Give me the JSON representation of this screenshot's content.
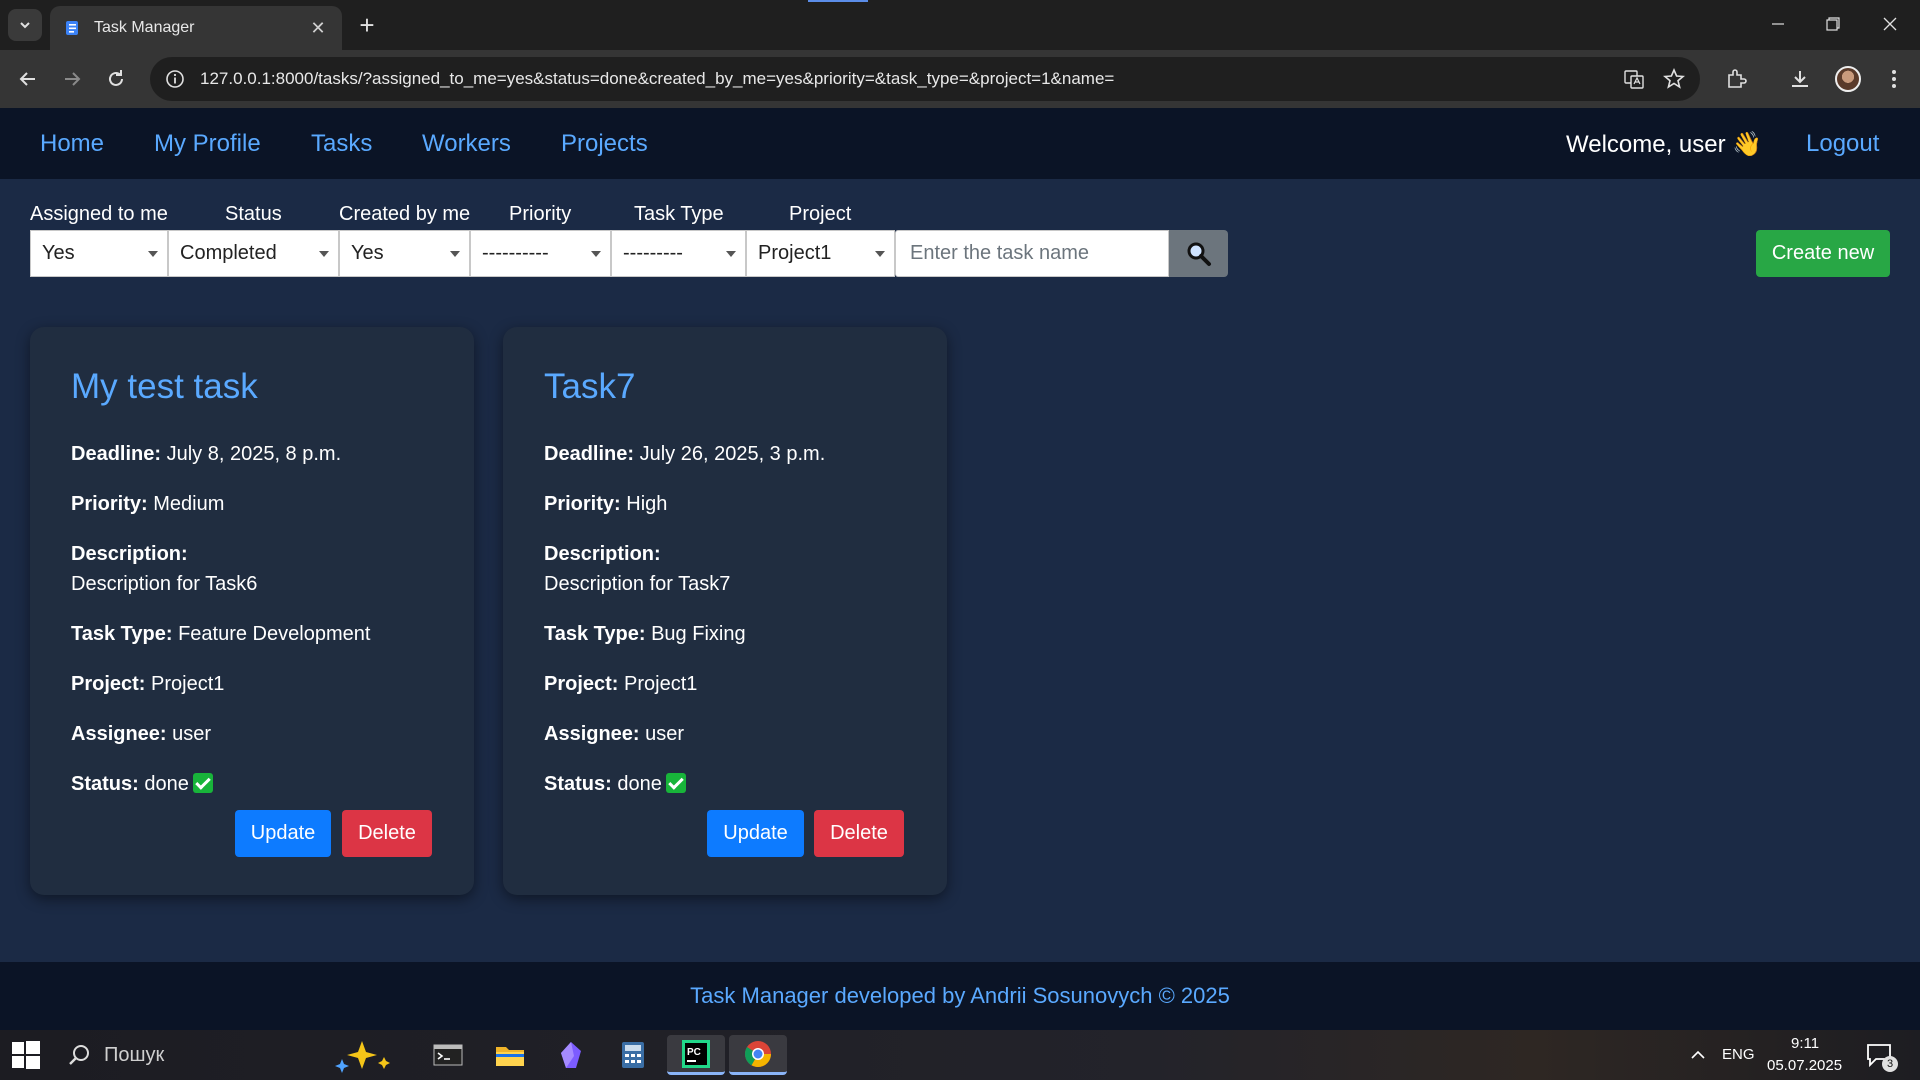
{
  "browser": {
    "tab_title": "Task Manager",
    "url": "127.0.0.1:8000/tasks/?assigned_to_me=yes&status=done&created_by_me=yes&priority=&task_type=&project=1&name="
  },
  "nav": {
    "links": [
      "Home",
      "My Profile",
      "Tasks",
      "Workers",
      "Projects"
    ],
    "welcome": "Welcome, user 👋",
    "logout": "Logout"
  },
  "filters": {
    "labels": [
      "Assigned to me",
      "Status",
      "Created by me",
      "Priority",
      "Task Type",
      "Project"
    ],
    "values": [
      "Yes",
      "Completed",
      "Yes",
      "----------",
      "---------",
      "Project1"
    ],
    "search_placeholder": "Enter the task name",
    "create_label": "Create new"
  },
  "cards": [
    {
      "title": "My test task",
      "deadline_label": "Deadline:",
      "deadline": "July 8, 2025, 8 p.m.",
      "priority_label": "Priority:",
      "priority": "Medium",
      "description_label": "Description:",
      "description": "Description for Task6",
      "type_label": "Task Type:",
      "type": "Feature Development",
      "project_label": "Project:",
      "project": "Project1",
      "assignee_label": "Assignee:",
      "assignee": "user",
      "status_label": "Status:",
      "status": "done",
      "update": "Update",
      "delete": "Delete"
    },
    {
      "title": "Task7",
      "deadline_label": "Deadline:",
      "deadline": "July 26, 2025, 3 p.m.",
      "priority_label": "Priority:",
      "priority": "High",
      "description_label": "Description:",
      "description": "Description for Task7",
      "type_label": "Task Type:",
      "type": "Bug Fixing",
      "project_label": "Project:",
      "project": "Project1",
      "assignee_label": "Assignee:",
      "assignee": "user",
      "status_label": "Status:",
      "status": "done",
      "update": "Update",
      "delete": "Delete"
    }
  ],
  "footer": "Task Manager developed by Andrii Sosunovych © 2025",
  "taskbar": {
    "search": "Пошук",
    "lang": "ENG",
    "time": "9:11",
    "date": "05.07.2025",
    "notifications": "3"
  },
  "colors": {
    "page_bg": "#1b2a45",
    "nav_bg": "#0b1426",
    "link": "#5aa9ff",
    "card_bg": "#202d40",
    "update": "#0d7bff",
    "delete": "#dc3545",
    "create": "#28a745"
  }
}
